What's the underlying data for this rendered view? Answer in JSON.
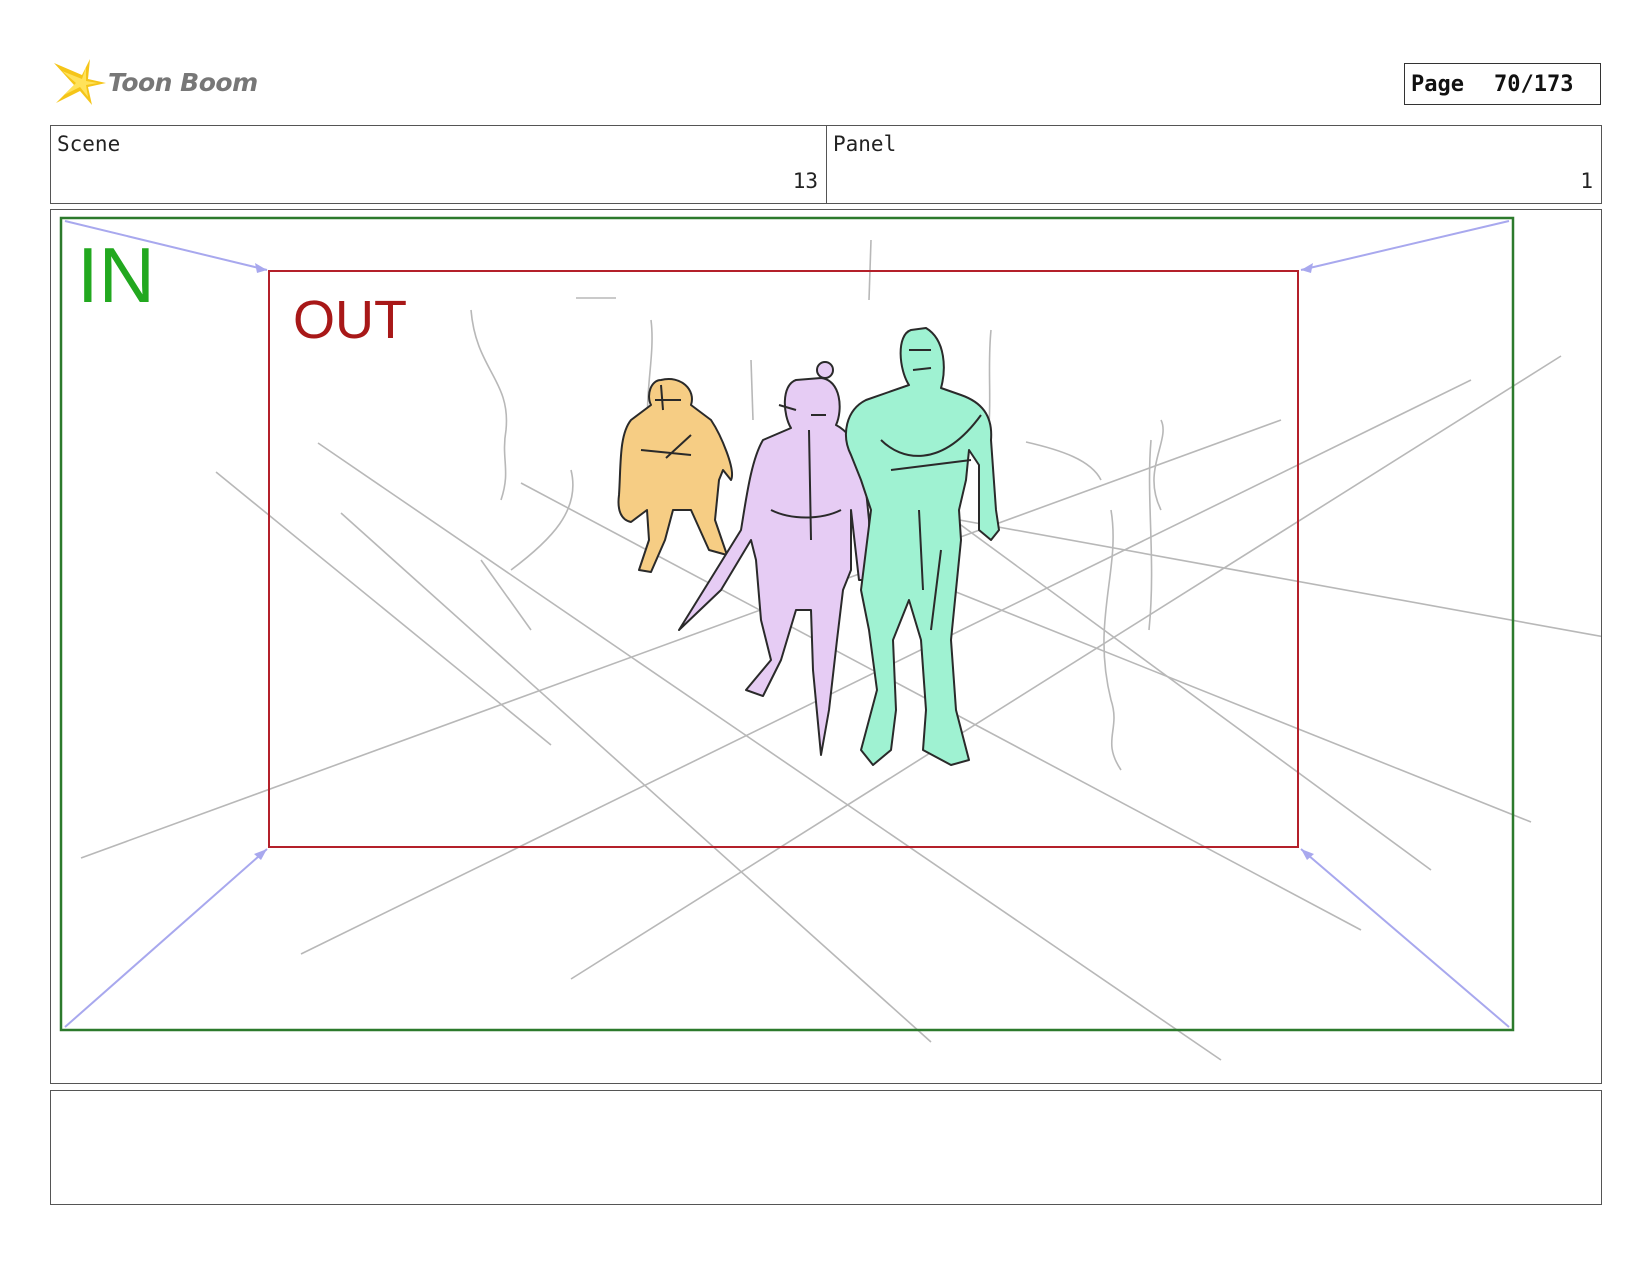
{
  "logo": {
    "text": "Toon Boom",
    "icon": "starburst-logo-icon"
  },
  "page": {
    "label": "Page",
    "value": "70/173"
  },
  "header": {
    "scene": {
      "label": "Scene",
      "value": "13"
    },
    "panel": {
      "label": "Panel",
      "value": "1"
    }
  },
  "frame": {
    "in_label": "IN",
    "out_label": "OUT",
    "in_color": "#22a81f",
    "out_color": "#a81818",
    "figure_colors": [
      "#f6cd84",
      "#e6ccf4",
      "#9ff2d2"
    ]
  },
  "notes": {
    "text": ""
  }
}
